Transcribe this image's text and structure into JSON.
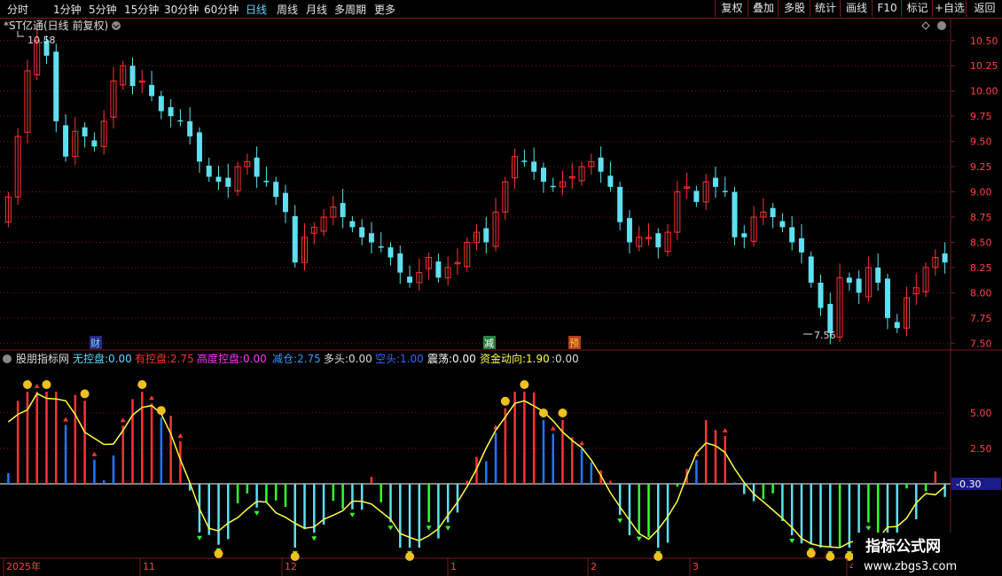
{
  "toolbar": {
    "timeframes": [
      {
        "label": "分时",
        "active": false
      },
      {
        "label": "1分钟",
        "active": false
      },
      {
        "label": "5分钟",
        "active": false
      },
      {
        "label": "15分钟",
        "active": false
      },
      {
        "label": "30分钟",
        "active": false
      },
      {
        "label": "60分钟",
        "active": false
      },
      {
        "label": "日线",
        "active": true
      },
      {
        "label": "周线",
        "active": false
      },
      {
        "label": "月线",
        "active": false
      },
      {
        "label": "多周期",
        "active": false
      },
      {
        "label": "更多",
        "active": false
      }
    ],
    "buttons": [
      "复权",
      "叠加",
      "多股",
      "统计",
      "画线",
      "F10",
      "标记",
      "+自选",
      "返回"
    ]
  },
  "main_chart": {
    "title": "*ST亿通(日线 前复权)",
    "high_marker": "10.58",
    "low_marker": "7.56",
    "price_ticks": [
      "10.50",
      "10.25",
      "10.00",
      "9.75",
      "9.50",
      "9.25",
      "9.00",
      "8.75",
      "8.50",
      "8.25",
      "8.00",
      "7.75",
      "7.50"
    ],
    "event_labels": [
      "财",
      "减",
      "预"
    ]
  },
  "indicator": {
    "name": "股朋指标网",
    "items": [
      {
        "label": "无控盘:",
        "value": "0.00",
        "color": "#5fd7ff"
      },
      {
        "label": "有控盘:",
        "value": "2.75",
        "color": "#ff3333"
      },
      {
        "label": "高度控盘:",
        "value": "0.00",
        "color": "#ff33ff"
      },
      {
        "label": "减仓:",
        "value": "2.75",
        "color": "#3399ff"
      },
      {
        "label": "多头:",
        "value": "0.00",
        "color": "#dddddd"
      },
      {
        "label": "空头:",
        "value": "1.00",
        "color": "#3366ff"
      },
      {
        "label": "震荡:",
        "value": "0.00",
        "color": "#ffffff"
      },
      {
        "label": "资金动向:",
        "value": "1.90",
        "color": "#ffff44"
      },
      {
        "label": ":",
        "value": "0.00",
        "color": "#dddddd"
      }
    ],
    "y_ticks": [
      "5.00",
      "2.50"
    ],
    "current_value": "-0.30"
  },
  "date_axis": [
    "2025年",
    "11",
    "12",
    "1",
    "2",
    "3",
    "4"
  ],
  "watermark": {
    "title": "指标公式网",
    "url": "www.zbgs3.com"
  },
  "colors": {
    "up": "#ff3333",
    "down": "#5fe0f0",
    "grid": "#7a1a1a",
    "yellow": "#ffff44",
    "green": "#33ff33"
  },
  "chart_data": {
    "type": "candlestick",
    "series": [
      {
        "name": "*ST亿通",
        "close": [
          8.95,
          9.55,
          10.2,
          10.5,
          10.35,
          9.7,
          9.35,
          9.6,
          9.55,
          9.45,
          9.7,
          10.1,
          10.25,
          10.05,
          10.1,
          9.95,
          9.8,
          9.75,
          9.7,
          9.55,
          9.3,
          9.15,
          9.1,
          9.05,
          9.25,
          9.3,
          9.15,
          9.1,
          8.95,
          8.8,
          8.3,
          8.55,
          8.65,
          8.75,
          8.85,
          8.75,
          8.65,
          8.55,
          8.5,
          8.45,
          8.35,
          8.2,
          8.1,
          8.2,
          8.35,
          8.15,
          8.25,
          8.3,
          8.5,
          8.6,
          8.5,
          8.8,
          9.1,
          9.35,
          9.3,
          9.2,
          9.1,
          9.05,
          9.1,
          9.15,
          9.25,
          9.3,
          9.2,
          9.05,
          8.7,
          8.5,
          8.55,
          8.55,
          8.45,
          8.6,
          9.0,
          9.05,
          8.9,
          9.1,
          9.05,
          9.0,
          8.55,
          8.55,
          8.75,
          8.8,
          8.75,
          8.65,
          8.5,
          8.4,
          8.1,
          7.85,
          7.6,
          8.15,
          8.1,
          8.0,
          8.25,
          8.1,
          7.75,
          7.65,
          7.95,
          8.05,
          8.25,
          8.35,
          8.3
        ]
      }
    ],
    "ylim": [
      7.45,
      10.7
    ],
    "indicator_ylim": [
      -5,
      8
    ]
  }
}
